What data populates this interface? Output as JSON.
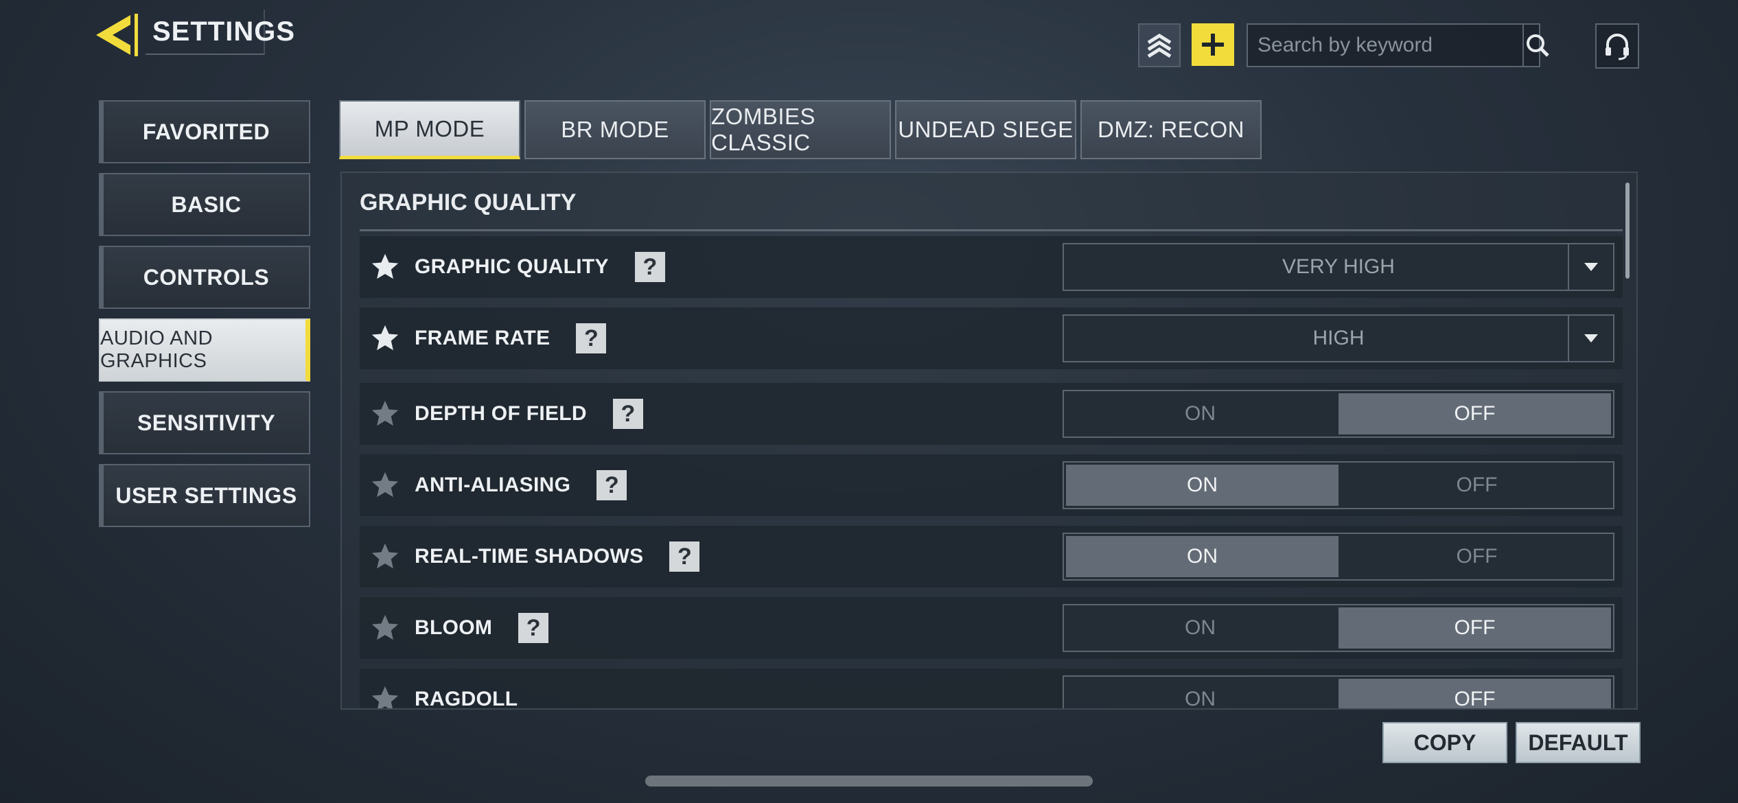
{
  "header": {
    "title": "SETTINGS"
  },
  "search": {
    "placeholder": "Search by keyword"
  },
  "sidebar": {
    "items": [
      {
        "label": "FAVORITED",
        "active": false
      },
      {
        "label": "BASIC",
        "active": false
      },
      {
        "label": "CONTROLS",
        "active": false
      },
      {
        "label": "AUDIO AND GRAPHICS",
        "active": true
      },
      {
        "label": "SENSITIVITY",
        "active": false
      },
      {
        "label": "USER SETTINGS",
        "active": false
      }
    ]
  },
  "tabs": [
    {
      "label": "MP MODE",
      "active": true
    },
    {
      "label": "BR MODE",
      "active": false
    },
    {
      "label": "ZOMBIES CLASSIC",
      "active": false
    },
    {
      "label": "UNDEAD SIEGE",
      "active": false
    },
    {
      "label": "DMZ: RECON",
      "active": false
    }
  ],
  "section": {
    "title": "GRAPHIC QUALITY"
  },
  "settings": [
    {
      "label": "GRAPHIC QUALITY",
      "favorited": true,
      "type": "dropdown",
      "value": "VERY HIGH"
    },
    {
      "label": "FRAME RATE",
      "favorited": true,
      "type": "dropdown",
      "value": "HIGH"
    },
    {
      "label": "DEPTH OF FIELD",
      "favorited": false,
      "type": "toggle",
      "on_label": "ON",
      "off_label": "OFF",
      "selected": "OFF"
    },
    {
      "label": "ANTI-ALIASING",
      "favorited": false,
      "type": "toggle",
      "on_label": "ON",
      "off_label": "OFF",
      "selected": "ON"
    },
    {
      "label": "REAL-TIME SHADOWS",
      "favorited": false,
      "type": "toggle",
      "on_label": "ON",
      "off_label": "OFF",
      "selected": "ON"
    },
    {
      "label": "BLOOM",
      "favorited": false,
      "type": "toggle",
      "on_label": "ON",
      "off_label": "OFF",
      "selected": "OFF"
    },
    {
      "label": "RAGDOLL",
      "favorited": false,
      "type": "toggle",
      "on_label": "ON",
      "off_label": "OFF",
      "selected": "OFF"
    }
  ],
  "help_glyph": "?",
  "buttons": {
    "copy": "COPY",
    "default": "DEFAULT"
  },
  "colors": {
    "accent": "#f2dc3c",
    "panel": "#2c343e",
    "selected_option": "#636c76"
  },
  "icons": [
    "back-arrow-icon",
    "rank-chevron-icon",
    "plus-icon",
    "search-icon",
    "headset-icon",
    "star-icon",
    "help-icon",
    "dropdown-arrow-icon"
  ]
}
